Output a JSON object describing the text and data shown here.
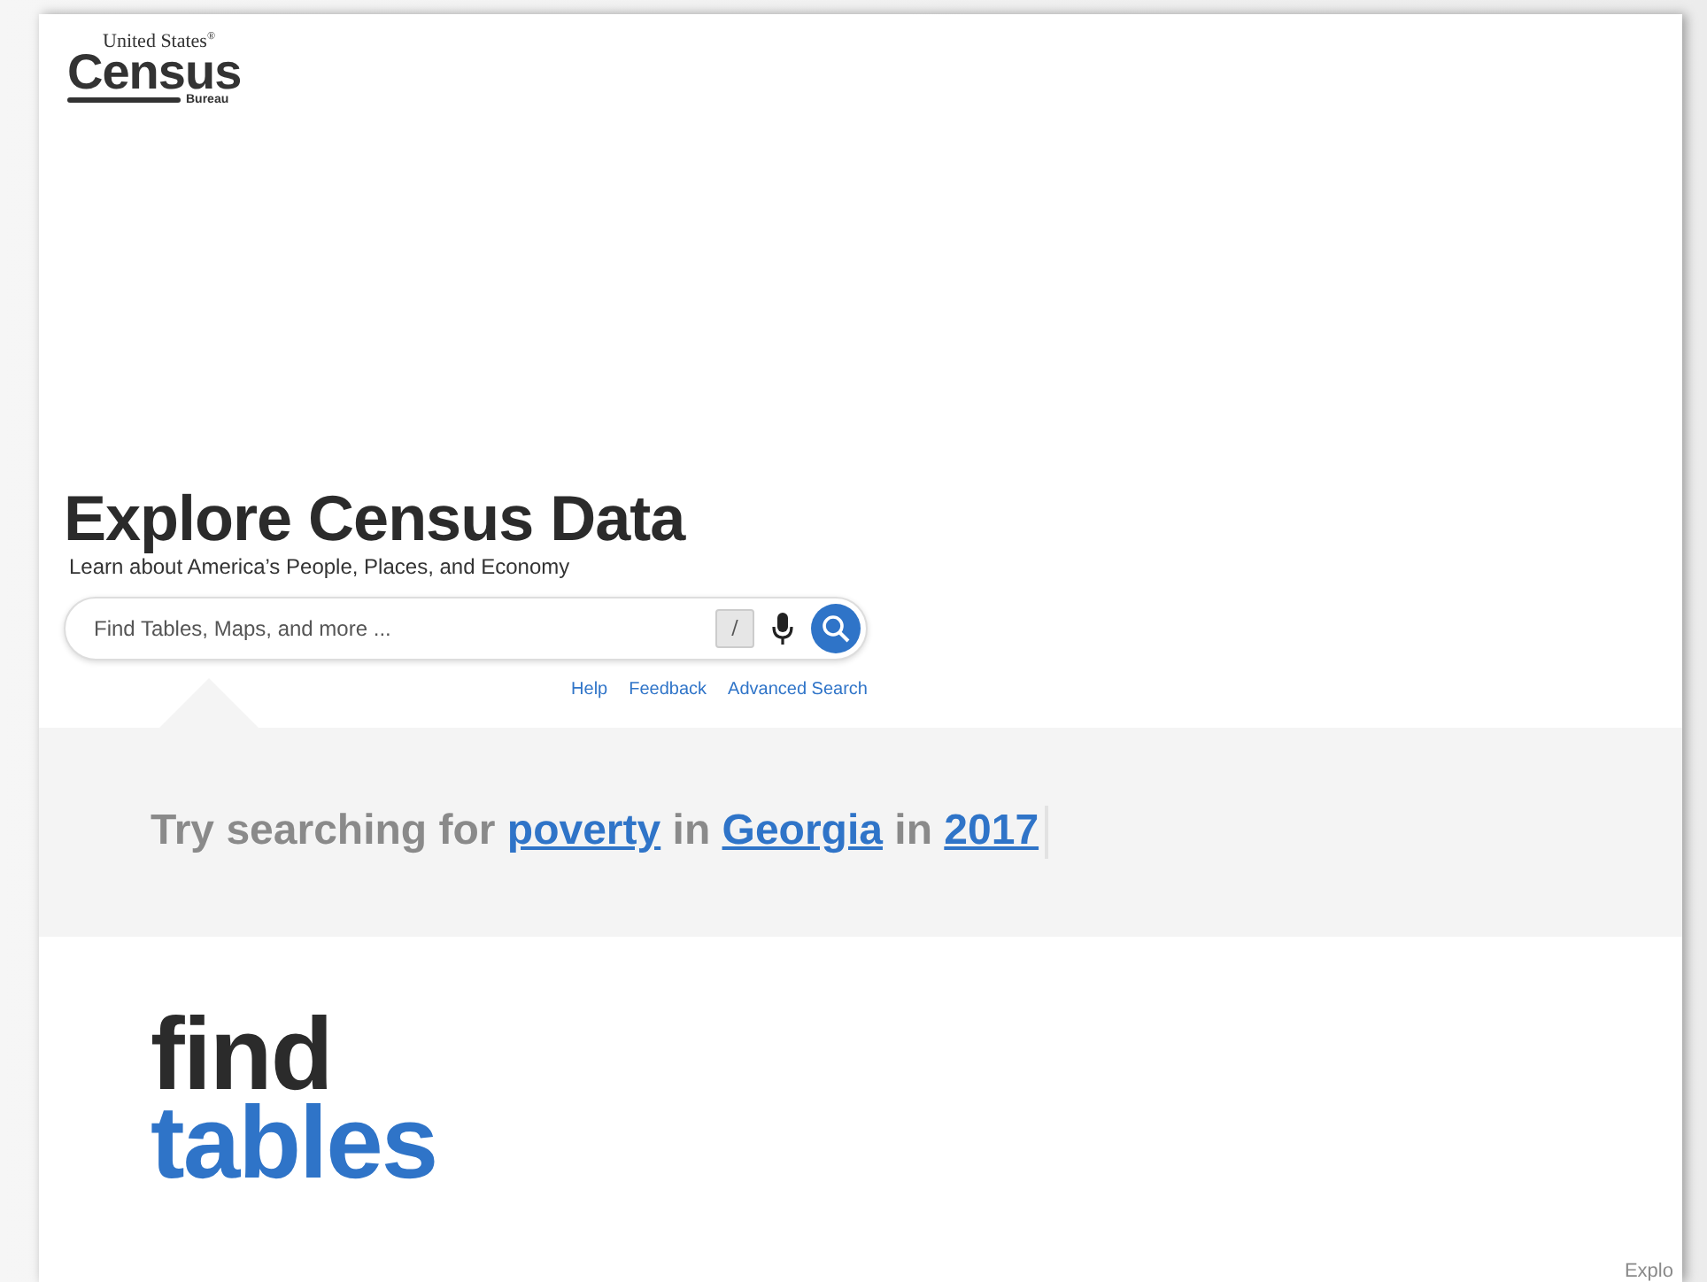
{
  "logo": {
    "top": "United States",
    "mark": "®",
    "main": "Census",
    "bottom": "Bureau"
  },
  "hero": {
    "title": "Explore Census Data",
    "subtitle": "Learn about America’s People, Places, and Economy"
  },
  "search": {
    "placeholder": "Find Tables, Maps, and more ...",
    "shortcut_key": "/"
  },
  "search_links": [
    "Help",
    "Feedback",
    "Advanced Search"
  ],
  "suggestion": [
    {
      "kind": "text",
      "text": "Try searching for"
    },
    {
      "kind": "link",
      "text": "poverty"
    },
    {
      "kind": "text",
      "text": "in"
    },
    {
      "kind": "link",
      "text": "Georgia"
    },
    {
      "kind": "text",
      "text": "in"
    },
    {
      "kind": "link",
      "text": "2017"
    }
  ],
  "feature": {
    "line_1": "find",
    "line_2": "tables"
  },
  "footer_peek": "Explo"
}
